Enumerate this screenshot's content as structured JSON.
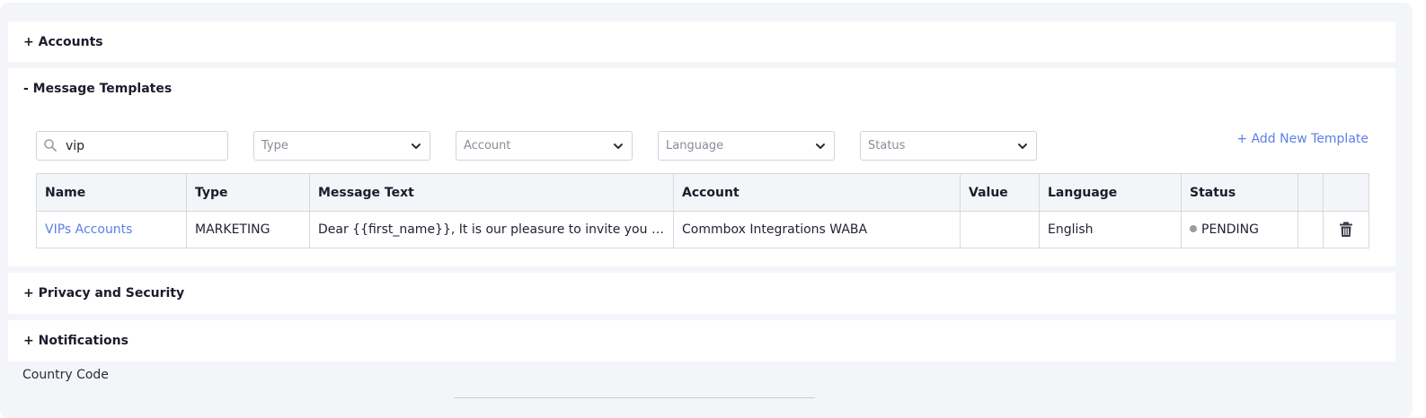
{
  "sections": {
    "accounts": "+ Accounts",
    "message_templates": "- Message Templates",
    "privacy": "+ Privacy and Security",
    "notifications": "+ Notifications"
  },
  "filters": {
    "search_value": "vip",
    "type_placeholder": "Type",
    "account_placeholder": "Account",
    "language_placeholder": "Language",
    "status_placeholder": "Status",
    "add_new_template": "+ Add New Template"
  },
  "table": {
    "columns": [
      "Name",
      "Type",
      "Message Text",
      "Account",
      "Value",
      "Language",
      "Status",
      "",
      ""
    ],
    "rows": [
      {
        "name": "VIPs Accounts",
        "type": "MARKETING",
        "message_text": "Dear {{first_name}}, It is our pleasure to invite you to our exclusive VIP event",
        "account": "Commbox Integrations WABA",
        "value": "",
        "language": "English",
        "status": "PENDING",
        "status_color": "#9a9ca3"
      }
    ]
  },
  "country_code_label": "Country Code",
  "colors": {
    "accent": "#5b7fe6",
    "background": "#f4f5f9"
  },
  "icons": [
    "search-icon",
    "chevron-down-icon",
    "status-dot",
    "trash-icon"
  ]
}
